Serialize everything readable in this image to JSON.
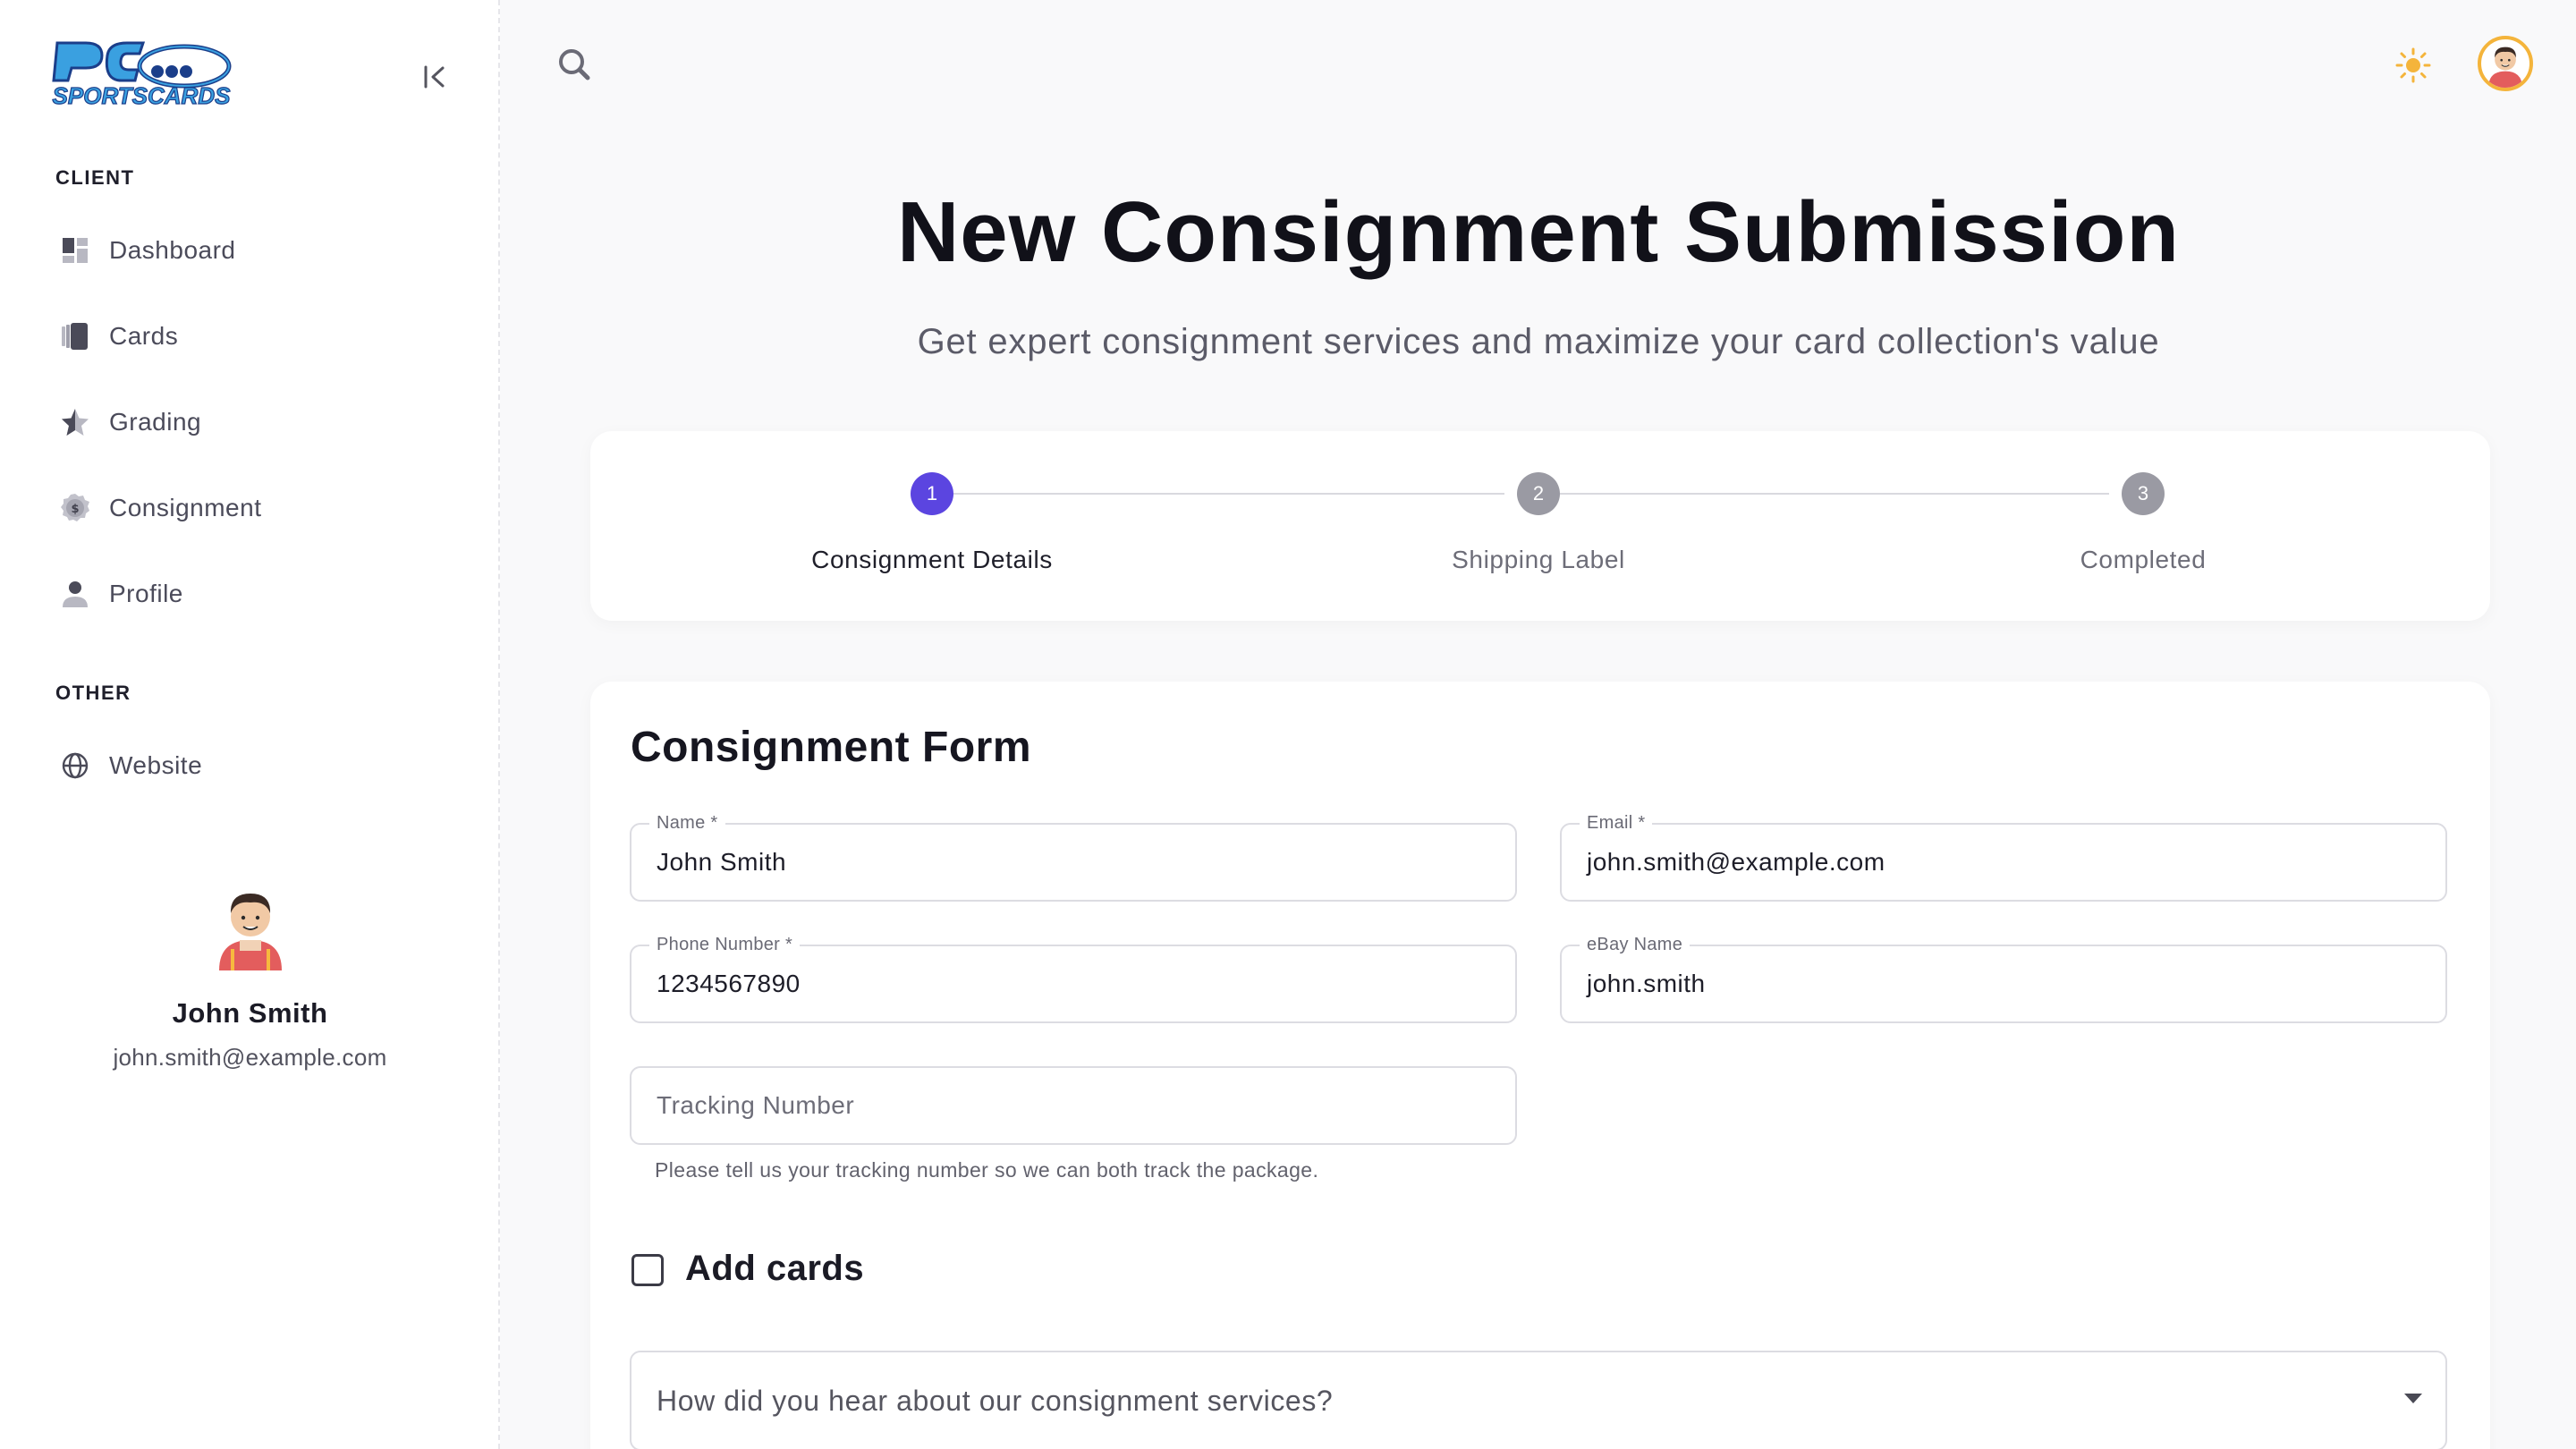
{
  "brand": {
    "logo_text_top": "PC",
    "logo_text_bottom": "SPORTSCARDS"
  },
  "sidebar": {
    "sections": [
      {
        "label": "CLIENT",
        "items": [
          {
            "label": "Dashboard",
            "icon": "dashboard-icon"
          },
          {
            "label": "Cards",
            "icon": "cards-icon"
          },
          {
            "label": "Grading",
            "icon": "grading-star-icon"
          },
          {
            "label": "Consignment",
            "icon": "consignment-coin-icon"
          },
          {
            "label": "Profile",
            "icon": "profile-icon"
          }
        ]
      },
      {
        "label": "OTHER",
        "items": [
          {
            "label": "Website",
            "icon": "globe-icon"
          }
        ]
      }
    ],
    "user": {
      "name": "John Smith",
      "email": "john.smith@example.com"
    }
  },
  "topbar": {
    "search_icon": "search-icon",
    "theme_icon": "sun-icon",
    "accent_color": "#f4b43b"
  },
  "page": {
    "title": "New Consignment Submission",
    "subtitle": "Get expert consignment services and maximize your card collection's value"
  },
  "stepper": {
    "active_color": "#5b45e0",
    "steps": [
      {
        "number": "1",
        "label": "Consignment Details",
        "state": "active"
      },
      {
        "number": "2",
        "label": "Shipping Label",
        "state": "inactive"
      },
      {
        "number": "3",
        "label": "Completed",
        "state": "inactive"
      }
    ]
  },
  "form": {
    "title": "Consignment Form",
    "name": {
      "label": "Name *",
      "value": "John Smith"
    },
    "email": {
      "label": "Email *",
      "value": "john.smith@example.com"
    },
    "phone": {
      "label": "Phone Number *",
      "value": "1234567890"
    },
    "ebay": {
      "label": "eBay Name",
      "value": "john.smith"
    },
    "tracking": {
      "placeholder": "Tracking Number",
      "helper": "Please tell us your tracking number so we can both track the package."
    },
    "add_cards": {
      "label": "Add cards",
      "checked": false
    },
    "referral": {
      "placeholder": "How did you hear about our consignment services?"
    }
  }
}
